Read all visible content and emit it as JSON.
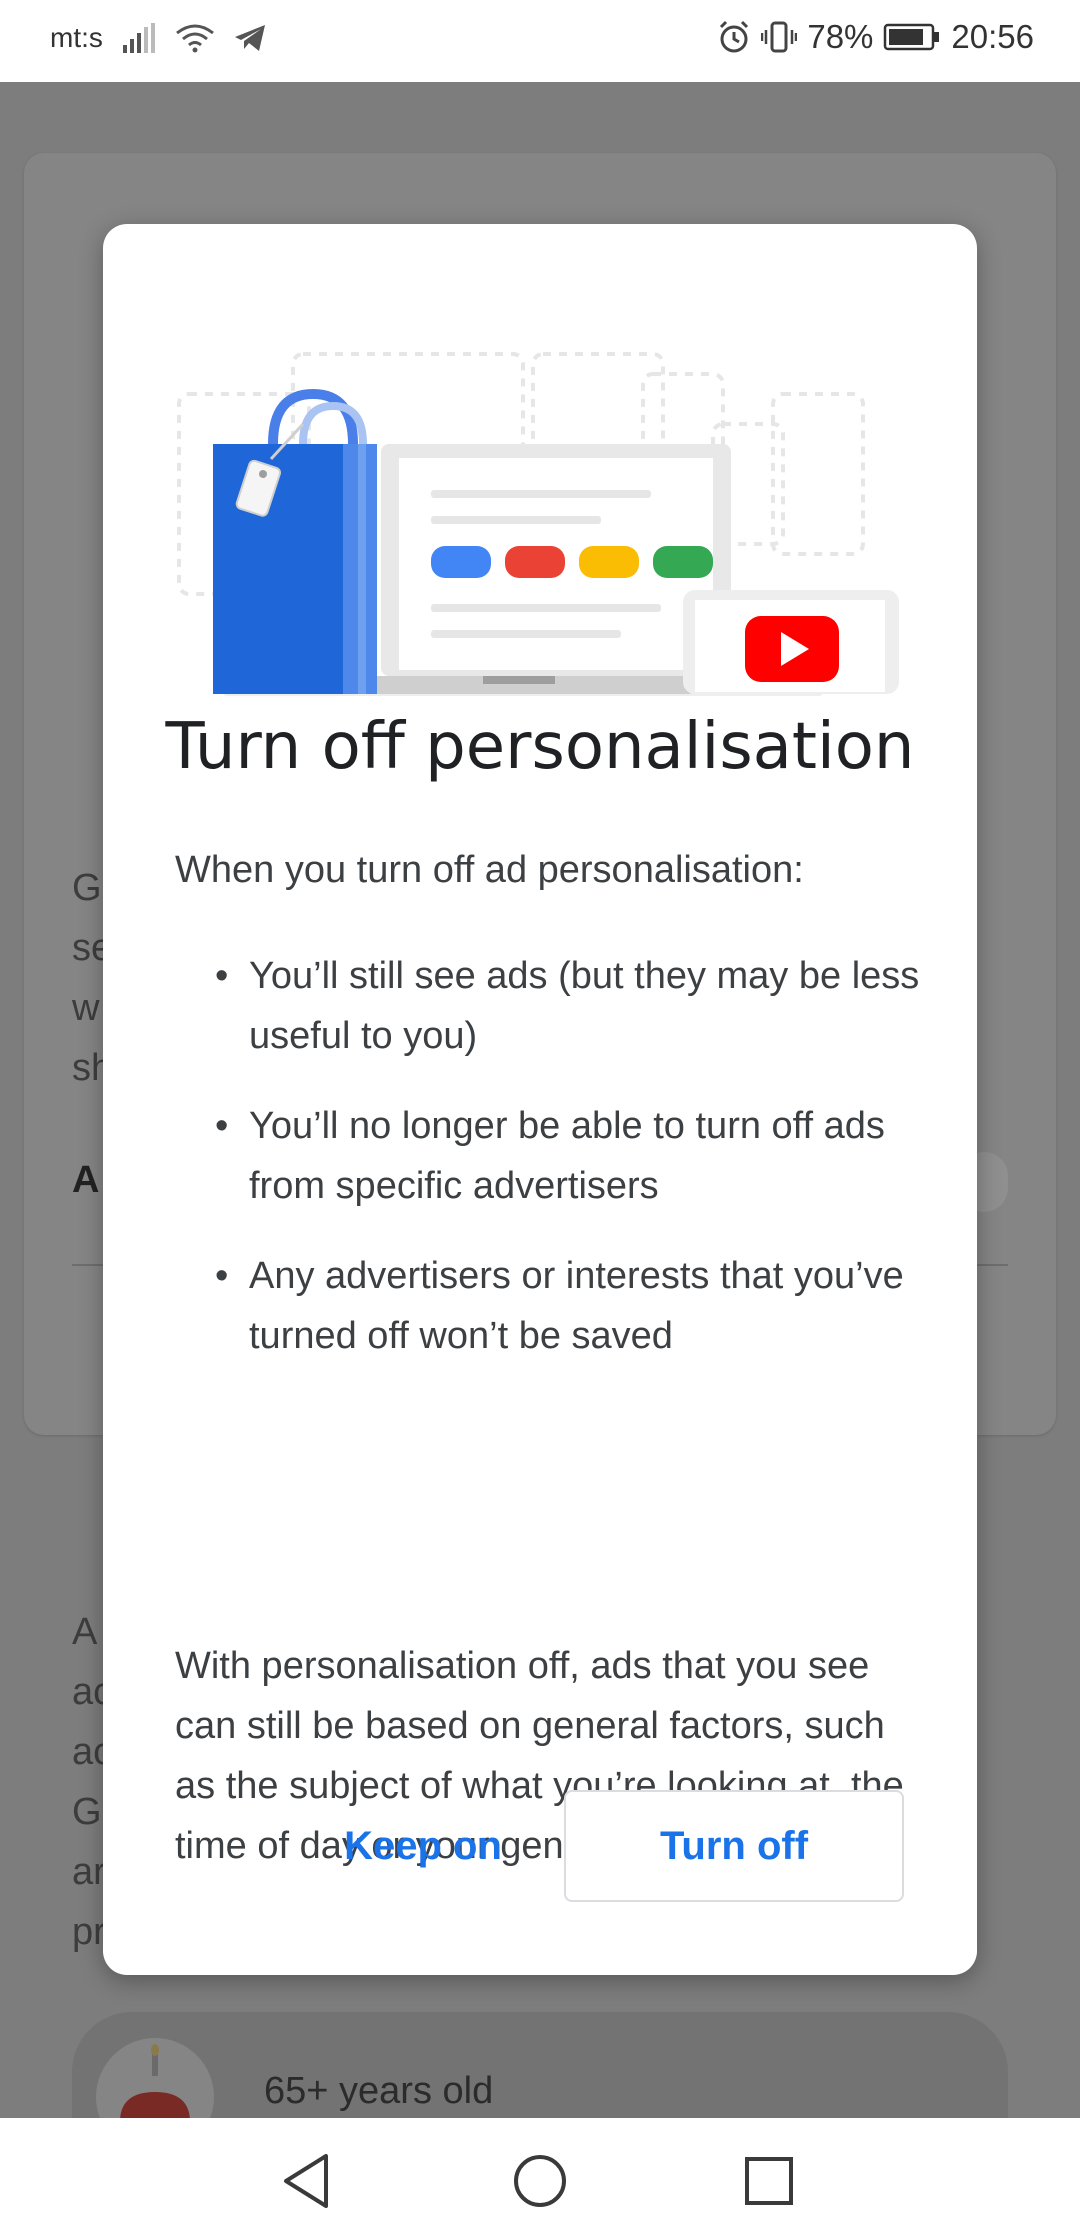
{
  "status_bar": {
    "carrier": "mt:s",
    "battery": "78%",
    "time": "20:56",
    "icons": [
      "signal-icon",
      "wifi-icon",
      "telegram-icon",
      "alarm-icon",
      "vibrate-icon",
      "battery-icon"
    ]
  },
  "background": {
    "fragments": [
      {
        "key": "line1",
        "text": "G"
      },
      {
        "key": "line2",
        "text": "se"
      },
      {
        "key": "line3",
        "text": "w"
      },
      {
        "key": "line4",
        "text": "sh"
      },
      {
        "key": "heading",
        "text": "A"
      },
      {
        "key": "line5",
        "text": "A"
      },
      {
        "key": "line6",
        "text": "ac"
      },
      {
        "key": "line7",
        "text": "ac"
      },
      {
        "key": "line8",
        "text": "G"
      },
      {
        "key": "line9",
        "text": "ar"
      },
      {
        "key": "line10",
        "text": "pr"
      }
    ],
    "age_item": "65+ years old"
  },
  "dialog": {
    "title": "Turn off personalisation",
    "intro": "When you turn off ad personalisation:",
    "bullets": [
      "You’ll still see ads (but they may be less useful to you)",
      "You’ll no longer be able to turn off ads from specific advertisers",
      "Any advertisers or interests that you’ve turned off won’t be saved"
    ],
    "paragraph": "With personalisation off, ads that you see can still be based on general factors, such as the subject of what you’re looking at, the time of day or your general location.",
    "keep_label": "Keep on",
    "off_label": "Turn off",
    "accent_color": "#1a73e8"
  },
  "nav": {
    "icons": [
      "back-icon",
      "home-icon",
      "recents-icon"
    ]
  }
}
